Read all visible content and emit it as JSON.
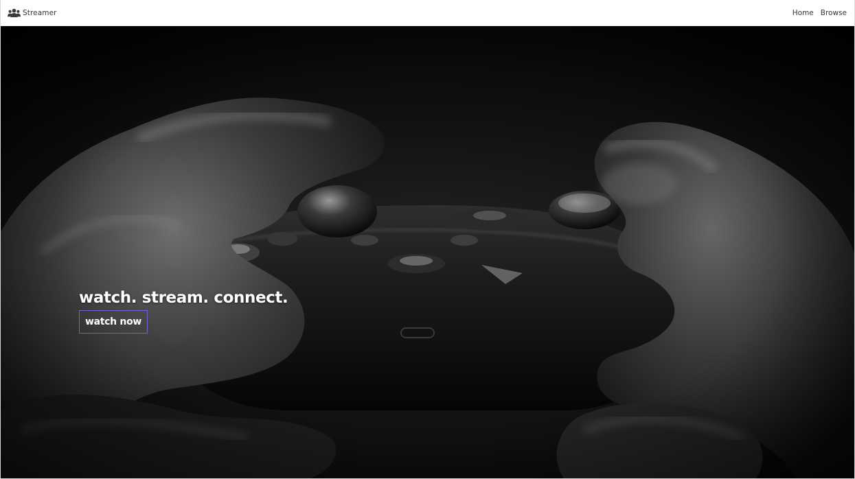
{
  "navbar": {
    "brand_label": "Streamer",
    "brand_icon": "users-icon",
    "links": [
      {
        "label": "Home"
      },
      {
        "label": "Browse"
      }
    ]
  },
  "hero": {
    "image": "game-controller-photo",
    "headline": "watch. stream. connect.",
    "cta_label": "watch now",
    "cta_border_color": "#7b5bd6"
  }
}
